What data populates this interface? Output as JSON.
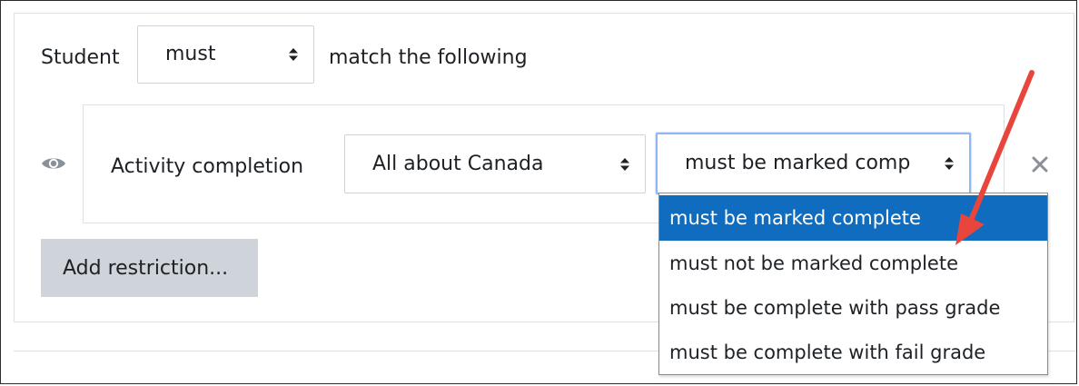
{
  "rule": {
    "prefix": "Student",
    "mode_select_value": "must",
    "suffix": "match the following"
  },
  "condition": {
    "type_label": "Activity completion",
    "activity_select_value": "All about Canada",
    "completion_select_value": "must be marked comp",
    "options": [
      "must be marked complete",
      "must not be marked complete",
      "must be complete with pass grade",
      "must be complete with fail grade"
    ],
    "selected_index": 0
  },
  "add_button_label": "Add restriction...",
  "icons": {
    "visibility": "eye-icon",
    "remove": "close-icon",
    "select_arrow": "sort-arrows-icon"
  },
  "colors": {
    "selected_option_bg": "#0f6cbf",
    "annotation_arrow": "#e8453c",
    "button_bg": "#ced4da"
  }
}
